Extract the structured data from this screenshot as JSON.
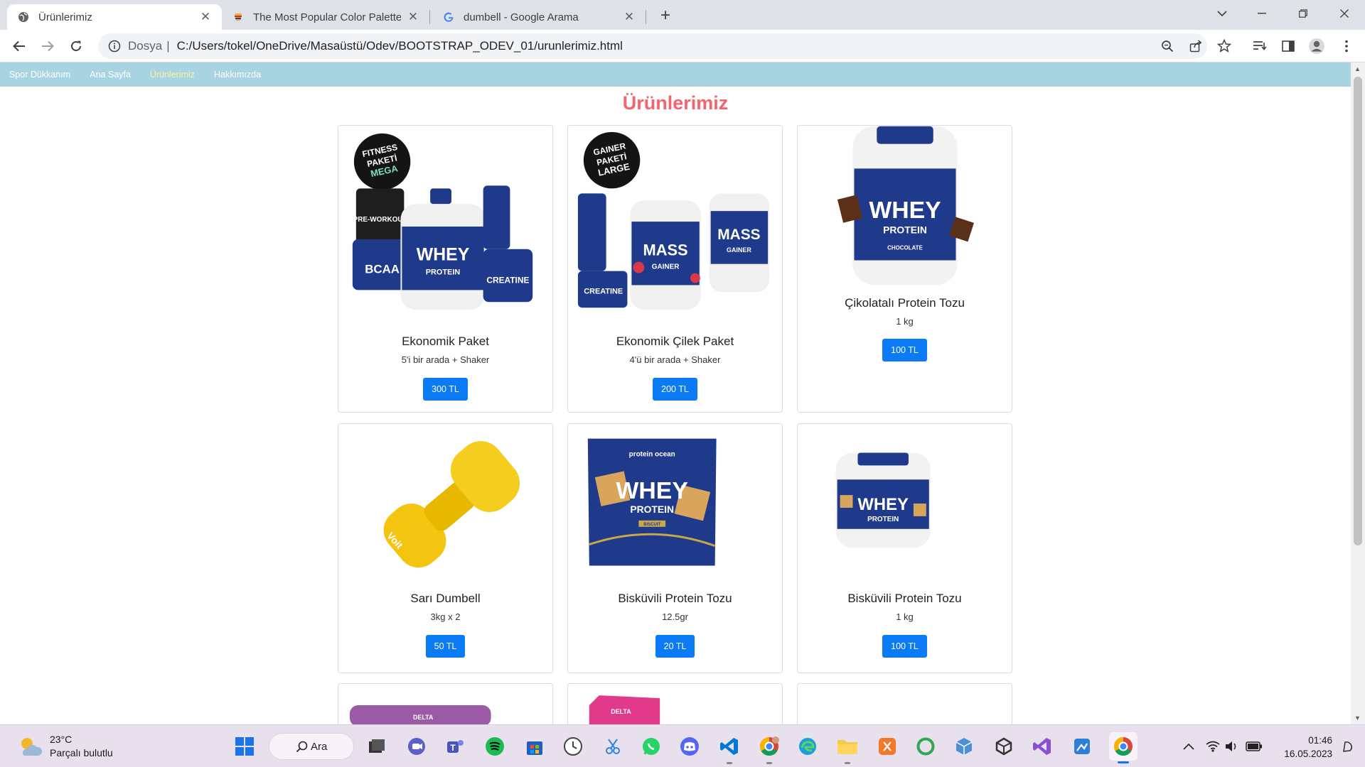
{
  "browser": {
    "tabs": [
      {
        "label": "Ürünlerimiz",
        "active": true
      },
      {
        "label": "The Most Popular Color Palettes",
        "active": false
      },
      {
        "label": "dumbell - Google Arama",
        "active": false
      }
    ],
    "address": {
      "scheme_label": "Dosya",
      "url": "C:/Users/tokel/OneDrive/Masaüstü/Odev/BOOTSTRAP_ODEV_01/urunlerimiz.html"
    }
  },
  "navbar": {
    "brand": "Spor Dükkanım",
    "links": [
      "Ana Sayfa",
      "Ürünlerimiz",
      "Hakkımızda"
    ],
    "active_link": "Ürünlerimiz"
  },
  "page": {
    "title": "Ürünlerimiz",
    "products": [
      {
        "name": "Ekonomik Paket",
        "desc": "5'i bir arada + Shaker",
        "price": "300 TL",
        "img_text": [
          "FITNESS",
          "PAKETİ",
          "MEGA",
          "PRE-WORKOUT",
          "BCAA",
          "WHEY",
          "PROTEIN",
          "CREATINE"
        ]
      },
      {
        "name": "Ekonomik Çilek Paket",
        "desc": "4'ü bir arada + Shaker",
        "price": "200 TL",
        "img_text": [
          "GAINER",
          "PAKETİ",
          "LARGE",
          "MASS",
          "GAINER",
          "MASS",
          "GAINER",
          "CREATINE"
        ]
      },
      {
        "name": "Çikolatalı Protein Tozu",
        "desc": "1 kg",
        "price": "100 TL",
        "img_text": [
          "WHEY",
          "PROTEIN",
          "CHOCOLATE"
        ]
      },
      {
        "name": "Sarı Dumbell",
        "desc": "3kg x 2",
        "price": "50 TL",
        "img_text": [
          "Voit"
        ]
      },
      {
        "name": "Bisküvili Protein Tozu",
        "desc": "12.5gr",
        "price": "20 TL",
        "img_text": [
          "protein ocean",
          "WHEY",
          "PROTEIN",
          "BISCUIT"
        ]
      },
      {
        "name": "Bisküvili Protein Tozu",
        "desc": "1 kg",
        "price": "100 TL",
        "img_text": [
          "WHEY",
          "PROTEIN"
        ]
      }
    ],
    "partial_row_text": [
      "DELTA",
      "DELTA"
    ]
  },
  "taskbar": {
    "weather": {
      "temp": "23°C",
      "condition": "Parçalı bulutlu"
    },
    "search_label": "Ara",
    "time": "01:46",
    "date": "16.05.2023"
  },
  "colors": {
    "navbar_bg": "#a8d4e2",
    "title": "#f4636e",
    "button": "#0a7bf5",
    "active_link": "#f7f3a0"
  }
}
